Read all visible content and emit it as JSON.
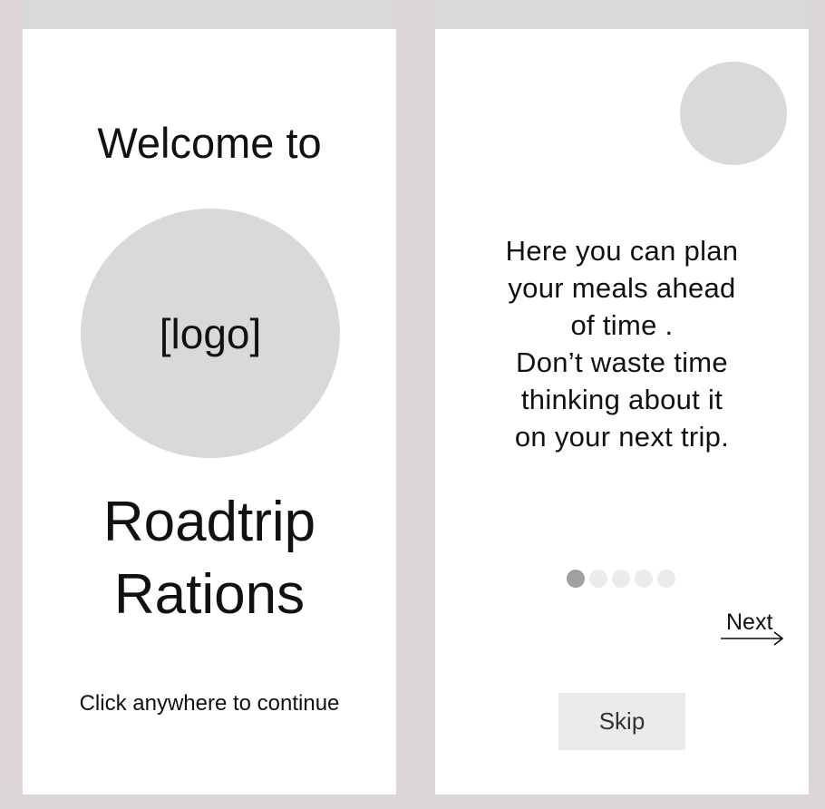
{
  "welcome": {
    "title": "Welcome to",
    "logo_placeholder": "[logo]",
    "app_name_line1": "Roadtrip",
    "app_name_line2": "Rations",
    "continue_hint": "Click anywhere to continue"
  },
  "onboarding": {
    "message_lines": [
      "Here you can plan",
      "your meals ahead",
      "of time .",
      "Don’t waste time",
      "thinking about it",
      "on your next trip."
    ],
    "pagination": {
      "total": 5,
      "current": 1
    },
    "next_label": "Next",
    "skip_label": "Skip"
  },
  "colors": {
    "page_background": "#dcd6d6",
    "screen_background": "#ffffff",
    "placeholder_gray": "#d9d9d9",
    "button_gray": "#ebebeb",
    "active_dot": "#a0a0a0"
  }
}
